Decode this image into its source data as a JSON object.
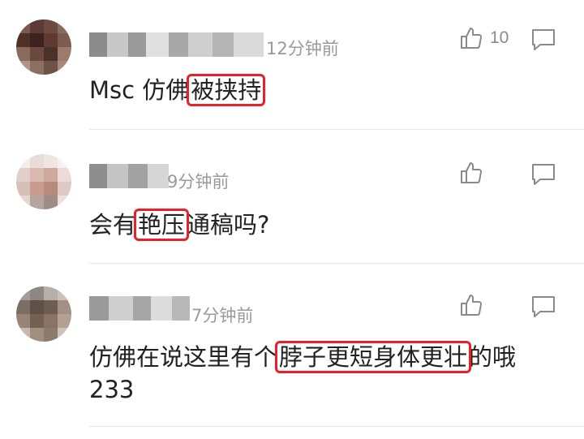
{
  "comments": [
    {
      "time": "12分钟前",
      "likes": "10",
      "text_before": "Msc 仿佛",
      "text_highlight": "被挟持",
      "text_after": ""
    },
    {
      "time": "9分钟前",
      "likes": "",
      "text_before": "会有",
      "text_highlight": "艳压",
      "text_after": "通稿吗?"
    },
    {
      "time": "7分钟前",
      "likes": "",
      "text_before": "仿佛在说这里有个",
      "text_highlight": "脖子更短身体更壮",
      "text_after": "的哦",
      "text_line2": "233"
    }
  ],
  "icons": {
    "like": "thumbs-up-icon",
    "reply": "comment-icon"
  },
  "colors": {
    "highlight": "#e8202a",
    "text": "#222222",
    "meta": "#9a9a9a"
  }
}
